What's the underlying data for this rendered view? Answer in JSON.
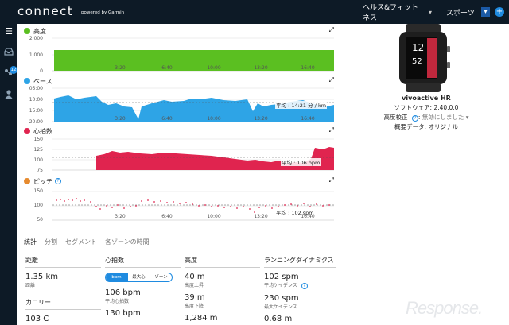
{
  "header": {
    "logo": "connect",
    "logo_sub": "powered by Garmin",
    "nav_health": "ヘルス&フィットネス",
    "nav_sports": "スポーツ",
    "plus": "+"
  },
  "sidebar": {
    "badge": "12"
  },
  "charts": {
    "elevation": {
      "title": "高度",
      "color": "#5bbf21",
      "y_ticks": [
        "2,000",
        "1,000",
        "0"
      ],
      "x_ticks": [
        "3:20",
        "6:40",
        "10:00",
        "13:20",
        "16:40"
      ]
    },
    "pace": {
      "title": "ペース",
      "color": "#2ea4e6",
      "y_ticks": [
        "05:00",
        "10:00",
        "15:00",
        "20:00"
      ],
      "x_ticks": [
        "3:20",
        "6:40",
        "10:00",
        "13:20",
        "16:40"
      ],
      "avg_label": "平均 : 14:21 分 / km"
    },
    "heart_rate": {
      "title": "心拍数",
      "color": "#e0244f",
      "y_ticks": [
        "150",
        "125",
        "100",
        "75"
      ],
      "x_ticks": [
        "3:20",
        "6:40",
        "10:00",
        "13:20",
        "16:40"
      ],
      "avg_label": "平均 : 106 bpm"
    },
    "cadence": {
      "title": "ピッチ",
      "color": "#e68a2e",
      "y_ticks": [
        "150",
        "100",
        "50"
      ],
      "x_ticks": [
        "3:20",
        "6:40",
        "10:00",
        "13:20",
        "16:40"
      ],
      "avg_label": "平均 : 102 spm"
    }
  },
  "tabs": [
    "統計",
    "分割",
    "セグメント",
    "各ゾーンの時間"
  ],
  "stats": {
    "distance": {
      "title": "距離",
      "value": "1.35 km",
      "label": "距離"
    },
    "calories": {
      "title": "カロリー",
      "value": "103 C"
    },
    "heart_rate": {
      "title": "心拍数",
      "segments": [
        "bpm",
        "最大心拍%",
        "ゾーン"
      ],
      "avg_value": "106 bpm",
      "avg_label": "平均心拍数",
      "max_value": "130 bpm"
    },
    "elevation": {
      "title": "高度",
      "gain_value": "40 m",
      "gain_label": "高度上昇",
      "loss_value": "39 m",
      "loss_label": "高度下降",
      "max_value": "1,284 m"
    },
    "running_dynamics": {
      "title": "ランニングダイナミクス",
      "avg_cadence_value": "102 spm",
      "avg_cadence_label": "平均ケイデンス",
      "max_cadence_value": "230 spm",
      "max_cadence_label": "最大ケイデンス",
      "stride_value": "0.68 m"
    }
  },
  "device": {
    "name": "vivoactive HR",
    "software": "ソフトウェア: 2.40.0.0",
    "elevation_correction": "高度校正",
    "elevation_correction_value": "無効にしました",
    "summary_data": "概要データ: オリジナル"
  },
  "watermark": "Response."
}
